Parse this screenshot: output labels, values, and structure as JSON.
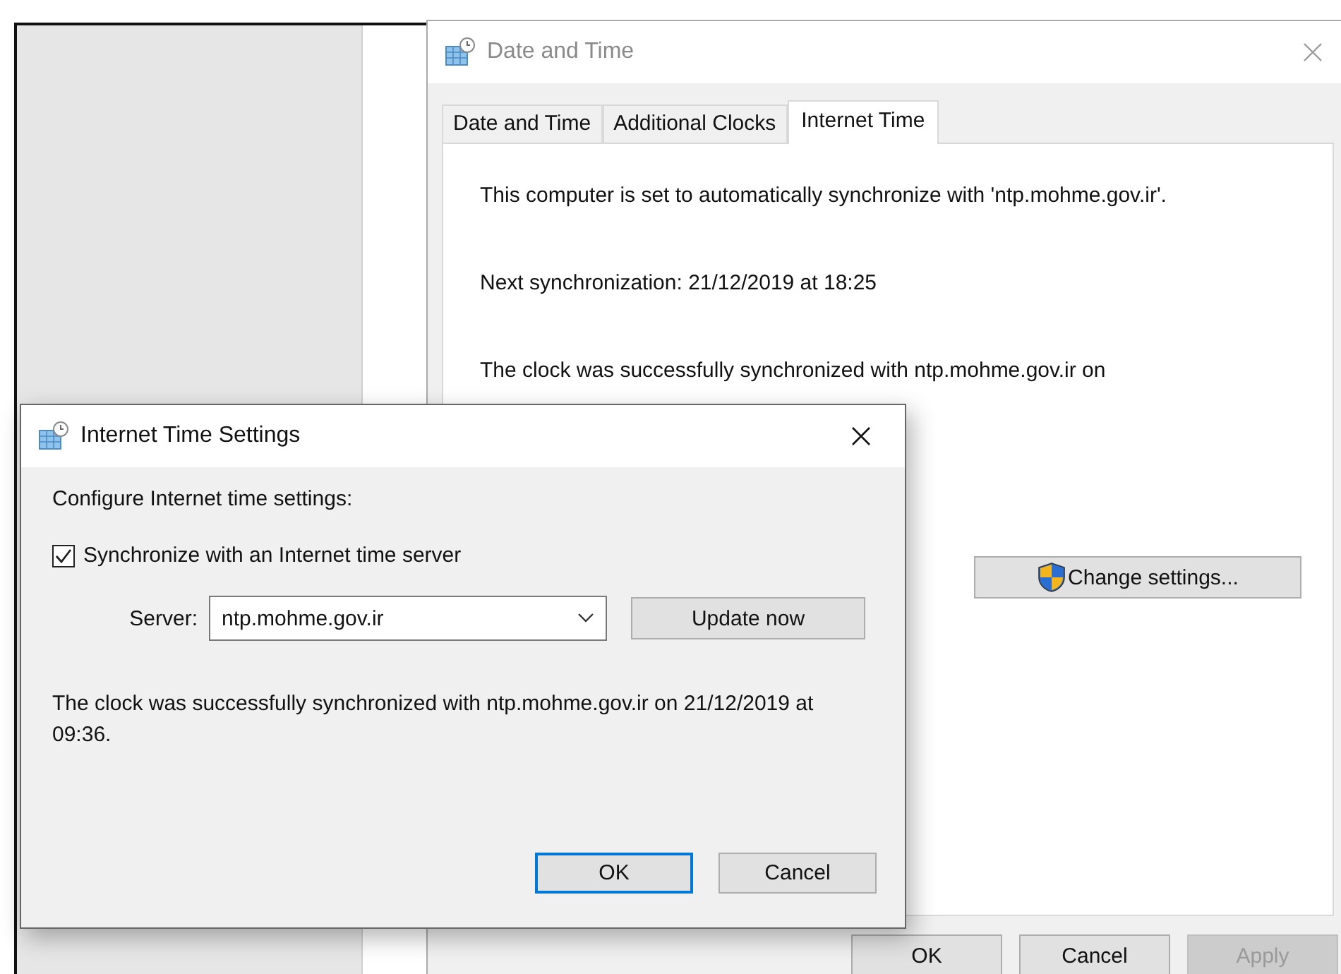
{
  "date_time_window": {
    "title": "Date and Time",
    "tabs": [
      {
        "label": "Date and Time",
        "selected": false
      },
      {
        "label": "Additional Clocks",
        "selected": false
      },
      {
        "label": "Internet Time",
        "selected": true
      }
    ],
    "auto_sync_text": "This computer is set to automatically synchronize with 'ntp.mohme.gov.ir'.",
    "next_sync_text": "Next synchronization: 21/12/2019 at 18:25",
    "last_sync_text": "The clock was successfully synchronized with ntp.mohme.gov.ir on",
    "change_settings_button": "Change settings...",
    "buttons": [
      {
        "label": "OK",
        "disabled": false
      },
      {
        "label": "Cancel",
        "disabled": false
      },
      {
        "label": "Apply",
        "disabled": true
      }
    ]
  },
  "internet_time_settings": {
    "title": "Internet Time Settings",
    "heading": "Configure Internet time settings:",
    "sync_checkbox": {
      "label": "Synchronize with an Internet time server",
      "checked": true
    },
    "server_label": "Server:",
    "server_value": "ntp.mohme.gov.ir",
    "update_button": "Update now",
    "status_text": "The clock was successfully synchronized with ntp.mohme.gov.ir on 21/12/2019 at 09:36.",
    "buttons": [
      {
        "label": "OK",
        "default": true
      },
      {
        "label": "Cancel",
        "default": false
      }
    ]
  }
}
